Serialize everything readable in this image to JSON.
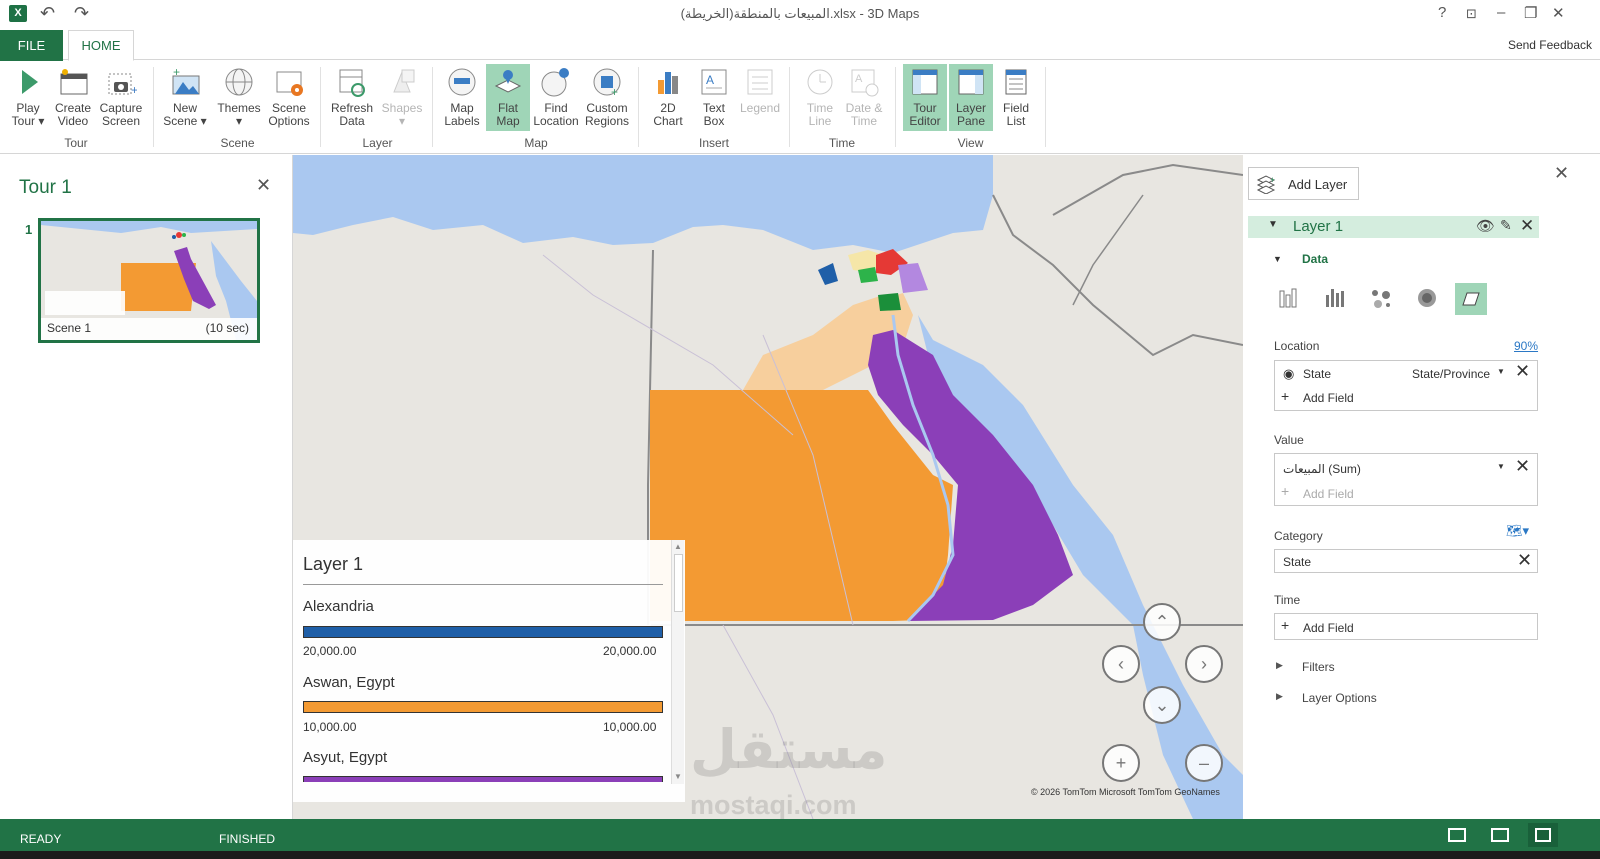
{
  "titlebar": {
    "app_icon": "X",
    "title": "المبيعات بالمنطقة(الخريطة).xlsx - 3D Maps",
    "undo_icon": "↶",
    "redo_icon": "↷",
    "help": "?",
    "minimize": "–",
    "restore": "❐",
    "close": "✕"
  },
  "tabs": {
    "file": "FILE",
    "home": "HOME",
    "send_feedback": "Send Feedback"
  },
  "ribbon": {
    "groups": {
      "tour": "Tour",
      "scene": "Scene",
      "layer": "Layer",
      "map": "Map",
      "insert": "Insert",
      "time": "Time",
      "view": "View"
    },
    "buttons": {
      "play_tour": [
        "Play",
        "Tour ▾"
      ],
      "create_video": [
        "Create",
        "Video"
      ],
      "capture_screen": [
        "Capture",
        "Screen"
      ],
      "new_scene": [
        "New",
        "Scene ▾"
      ],
      "themes": [
        "Themes",
        "▾"
      ],
      "scene_options": [
        "Scene",
        "Options"
      ],
      "refresh_data": [
        "Refresh",
        "Data"
      ],
      "shapes": [
        "Shapes",
        "▾"
      ],
      "map_labels": [
        "Map",
        "Labels"
      ],
      "flat_map": [
        "Flat",
        "Map"
      ],
      "find_location": [
        "Find",
        "Location"
      ],
      "custom_regions": [
        "Custom",
        "Regions"
      ],
      "chart_2d": [
        "2D",
        "Chart"
      ],
      "text_box": [
        "Text",
        "Box"
      ],
      "legend": [
        "Legend",
        ""
      ],
      "time_line": [
        "Time",
        "Line"
      ],
      "date_time": [
        "Date &",
        "Time"
      ],
      "tour_editor": [
        "Tour",
        "Editor"
      ],
      "layer_pane": [
        "Layer",
        "Pane"
      ],
      "field_list": [
        "Field",
        "List"
      ]
    }
  },
  "tour_pane": {
    "title": "Tour 1",
    "close": "✕",
    "scenes": [
      {
        "index": "1",
        "name": "Scene 1",
        "duration": "(10 sec)"
      }
    ]
  },
  "legend": {
    "title": "Layer 1",
    "items": [
      {
        "name": "Alexandria",
        "min": "20,000.00",
        "max": "20,000.00",
        "color": "#1f5fa8"
      },
      {
        "name": "Aswan, Egypt",
        "min": "10,000.00",
        "max": "10,000.00",
        "color": "#f39a33"
      },
      {
        "name": "Asyut, Egypt",
        "color": "#8b3fb8"
      }
    ]
  },
  "map": {
    "attribution": "© 2026 TomTom  Microsoft  TomTom  GeoNames",
    "colors": {
      "sea": "#aac8f0",
      "land": "#e8e6e1",
      "aswan": "#f39a33",
      "red_sea_gov": "#8b3fb8",
      "light": "#f7cf9d"
    },
    "nav": {
      "up": "⌃",
      "left": "‹",
      "right": "›",
      "down": "⌄",
      "zoom_in": "+",
      "zoom_out": "–"
    }
  },
  "layer_pane": {
    "add_layer": "Add Layer",
    "close": "✕",
    "layer_name": "Layer 1",
    "data_label": "Data",
    "location": {
      "label": "Location",
      "percent": "90%",
      "field": "State",
      "type": "State/Province",
      "add_field": "Add Field"
    },
    "value": {
      "label": "Value",
      "field": "المبيعات (Sum)",
      "add_field": "Add Field"
    },
    "category": {
      "label": "Category",
      "field": "State"
    },
    "time": {
      "label": "Time",
      "add_field": "Add Field"
    },
    "filters": "Filters",
    "layer_options": "Layer Options"
  },
  "status": {
    "ready": "READY",
    "finished": "FINISHED"
  },
  "watermark": {
    "arabic": "مستقل",
    "latin": "mostaqi.com"
  }
}
